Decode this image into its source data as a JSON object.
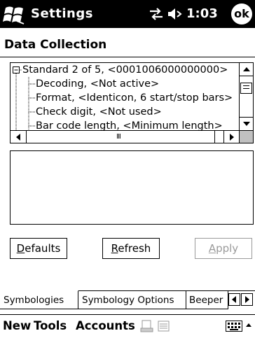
{
  "titlebar": {
    "title": "Settings",
    "time": "1:03",
    "ok_label": "ok",
    "icons": [
      "windows-start-icon",
      "connectivity-icon",
      "volume-icon"
    ]
  },
  "header": {
    "title": "Data Collection"
  },
  "tree": {
    "rows": [
      {
        "prefix": "⊟",
        "label": "Standard 2 of 5, <0001006000000000>"
      },
      {
        "prefix": "",
        "label": "Decoding, <Not active>"
      },
      {
        "prefix": "",
        "label": "Format, <Identicon, 6 start/stop bars>"
      },
      {
        "prefix": "",
        "label": "Check digit, <Not used>"
      },
      {
        "prefix": "",
        "label": "Bar code length, <Minimum length>"
      }
    ]
  },
  "buttons": {
    "defaults": {
      "first": "D",
      "rest": "efaults"
    },
    "refresh": {
      "first": "R",
      "rest": "efresh"
    },
    "apply": {
      "first": "A",
      "rest": "pply"
    }
  },
  "tabs": [
    {
      "label": "Symbologies",
      "active": true
    },
    {
      "label": "Symbology Options",
      "active": false
    },
    {
      "label": "Beeper",
      "active": false
    }
  ],
  "menubar": {
    "items": [
      "New",
      "Tools",
      "Accounts"
    ]
  },
  "colors": {
    "titlebar_bg": "#000000",
    "disabled_text": "#9a9a9a"
  }
}
